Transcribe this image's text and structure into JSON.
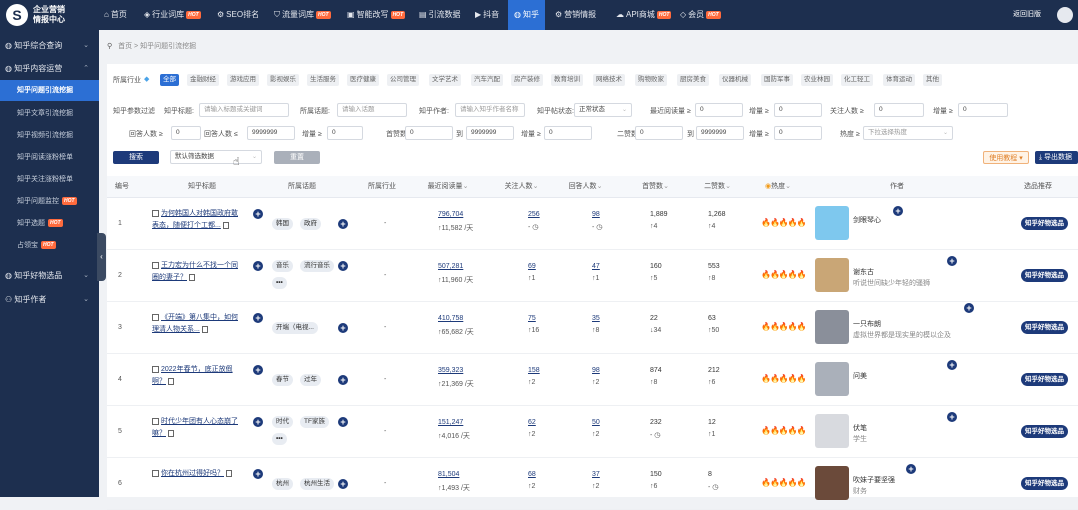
{
  "brand": {
    "line1": "企业营销",
    "line2": "情报中心",
    "mark": "S"
  },
  "nav": [
    {
      "label": "首页",
      "icon": "home-icon",
      "glyph": "⌂"
    },
    {
      "label": "行业词库",
      "icon": "cube-icon",
      "glyph": "◈",
      "hot": "HOT"
    },
    {
      "label": "SEO排名",
      "icon": "gear-icon",
      "glyph": "⚙"
    },
    {
      "label": "流量词库",
      "icon": "shield-icon",
      "glyph": "⛉",
      "hot": "HOT"
    },
    {
      "label": "智能改写",
      "icon": "robot-icon",
      "glyph": "▣",
      "hot": "HOT"
    },
    {
      "label": "引流数据",
      "icon": "book-icon",
      "glyph": "▤"
    },
    {
      "label": "抖音",
      "icon": "video-icon",
      "glyph": "▶"
    },
    {
      "label": "知乎",
      "icon": "globe-icon",
      "glyph": "◍"
    },
    {
      "label": "营销情报",
      "icon": "gear-icon",
      "glyph": "⚙"
    },
    {
      "label": "API商城",
      "icon": "cloud-icon",
      "glyph": "☁",
      "hot": "HOT"
    },
    {
      "label": "会员",
      "icon": "diamond-icon",
      "glyph": "◇",
      "hot": "HOT"
    }
  ],
  "back_old": "返回旧版",
  "sidebar": {
    "groups": [
      {
        "label": "知乎综合查询",
        "icon": "globe-icon"
      },
      {
        "label": "知乎内容运营",
        "icon": "globe-icon"
      },
      {
        "label": "知乎好物选品",
        "icon": "globe-icon"
      },
      {
        "label": "知乎作者",
        "icon": "user-icon"
      }
    ],
    "items": [
      {
        "label": "知乎问题引流挖掘"
      },
      {
        "label": "知乎文章引流挖掘"
      },
      {
        "label": "知乎视频引流挖掘"
      },
      {
        "label": "知乎阅读涨粉榜单"
      },
      {
        "label": "知乎关注涨粉榜单"
      },
      {
        "label": "知乎问题监控",
        "hot": "HOT"
      },
      {
        "label": "知乎选题",
        "hot": "HOT"
      },
      {
        "label": "占领宝",
        "hot": "HOT"
      }
    ]
  },
  "breadcrumb": {
    "home": "首页",
    "sep": ">",
    "current": "知乎问题引流挖掘"
  },
  "industry": {
    "label": "所属行业",
    "chips": [
      "全部",
      "金融财经",
      "游戏应用",
      "影视娱乐",
      "生活服务",
      "医疗健康",
      "公司管理",
      "文学艺术",
      "汽车汽配",
      "房产装修",
      "教育培训",
      "网络技术",
      "购物败家",
      "厨房美食",
      "仪器机械",
      "国防军事",
      "农业林园",
      "化工轻工",
      "体育运动",
      "其他"
    ]
  },
  "filters": {
    "section_label": "知乎参数过滤",
    "title_label": "知乎标题:",
    "title_ph": "请输入标题或关键词",
    "topic_label": "所属话题:",
    "topic_ph": "请输入话题",
    "author_label": "知乎作者:",
    "author_ph": "请输入知乎作者名称",
    "status_label": "知乎帖状态:",
    "status_value": "正常状态",
    "readmax_label": "最近阅读量 ≥",
    "readmax_val": "0",
    "inc1_label": "增量 ≥",
    "inc1_val": "0",
    "follow_label": "关注人数 ≥",
    "follow_val": "0",
    "inc2_label": "增量 ≥",
    "inc2_val": "0",
    "answer_label": "回答人数 ≥",
    "answer_val": "0",
    "answer2_label": "回答人数 ≤",
    "answer2_val": "9999999",
    "inc3_label": "增量 ≥",
    "inc3_val": "0",
    "likes_label": "首赞数",
    "likes_from": "0",
    "to1": "到",
    "likes_to": "9999999",
    "inc4_label": "增量 ≥",
    "inc4_val": "0",
    "likes2_label": "二赞数",
    "likes2_from": "0",
    "to2": "到",
    "likes2_to": "9999999",
    "inc5_label": "增量 ≥",
    "inc5_val": "0",
    "heat_label": "热度 ≥",
    "heat_ph": "下拉选择热度"
  },
  "actions": {
    "search": "搜索",
    "sort_value": "默认筛选数据",
    "reset": "重置",
    "tutorial": "使用教程 ▾",
    "export": "导出数据"
  },
  "columns": [
    "编号",
    "知乎标题",
    "所属话题",
    "所属行业",
    "最近阅读量",
    "关注人数",
    "回答人数",
    "首赞数",
    "二赞数",
    "热度",
    "作者",
    "选品推荐"
  ],
  "rows": [
    {
      "no": "1",
      "title": "为何韩国人对韩国政府敢表态，随便打个工都...",
      "tags": [
        "韩国",
        "政府"
      ],
      "industry": "-",
      "read": "796,704",
      "read_d": "↑11,582 /天",
      "follow": "256",
      "follow_d": "- ◷",
      "answer": "98",
      "answer_d": "- ◷",
      "like1": "1,889",
      "like1_d": "↑4",
      "like2": "1,268",
      "like2_d": "↑4",
      "heat": "🔥🔥🔥🔥🔥",
      "author": "剑眼琴心",
      "author_desc": "",
      "rec": "知乎好物选品",
      "av": "#7ec8ee"
    },
    {
      "no": "2",
      "title": "王力宏为什么不找一个同圈的妻子？",
      "tags": [
        "音乐",
        "流行音乐"
      ],
      "more": true,
      "industry": "-",
      "read": "507,281",
      "read_d": "↑11,960 /天",
      "follow": "69",
      "follow_d": "↑1",
      "answer": "47",
      "answer_d": "↑1",
      "like1": "160",
      "like1_d": "↑5",
      "like2": "553",
      "like2_d": "↑8",
      "heat": "🔥🔥🔥🔥🔥",
      "author": "谢东古",
      "author_desc": "听说世间缺少年轻的骚狮",
      "rec": "知乎好物选品",
      "av": "#c9a676"
    },
    {
      "no": "3",
      "title": "《开端》第八集中，如何理清人物关系...",
      "tags": [
        "开端（电视..."
      ],
      "industry": "-",
      "read": "410,758",
      "read_d": "↑65,682 /天",
      "follow": "75",
      "follow_d": "↑16",
      "answer": "35",
      "answer_d": "↑8",
      "like1": "22",
      "like1_d": "↓34",
      "like2": "63",
      "like2_d": "↑50",
      "heat": "🔥🔥🔥🔥🔥",
      "author": "一只布朗",
      "author_desc": "虚拟世界都是现实里的模以企及",
      "rec": "知乎好物选品",
      "av": "#8a8f9a"
    },
    {
      "no": "4",
      "title": "2022年春节，底正放假啊？",
      "tags": [
        "春节",
        "过年"
      ],
      "industry": "-",
      "read": "359,323",
      "read_d": "↑21,369 /天",
      "follow": "158",
      "follow_d": "↑2",
      "answer": "98",
      "answer_d": "↑2",
      "like1": "874",
      "like1_d": "↑8",
      "like2": "212",
      "like2_d": "↑6",
      "heat": "🔥🔥🔥🔥🔥",
      "author": "问美",
      "author_desc": "",
      "rec": "知乎好物选品",
      "av": "#aab0ba"
    },
    {
      "no": "5",
      "title": "时代少年团有人心态崩了嘛？",
      "tags": [
        "时代",
        "TF家族"
      ],
      "more": true,
      "industry": "-",
      "read": "151,247",
      "read_d": "↑4,016 /天",
      "follow": "62",
      "follow_d": "↑2",
      "answer": "50",
      "answer_d": "↑2",
      "like1": "232",
      "like1_d": "- ◷",
      "like2": "12",
      "like2_d": "↑1",
      "heat": "🔥🔥🔥🔥🔥",
      "author": "伏笔",
      "author_desc": "学生",
      "rec": "知乎好物选品",
      "av": "#d8dadf"
    },
    {
      "no": "6",
      "title": "你在杭州过得好吗？",
      "tags": [
        "杭州",
        "杭州生活"
      ],
      "industry": "-",
      "read": "81,504",
      "read_d": "↑1,493 /天",
      "follow": "68",
      "follow_d": "↑2",
      "answer": "37",
      "answer_d": "↑2",
      "like1": "150",
      "like1_d": "↑6",
      "like2": "8",
      "like2_d": "- ◷",
      "heat": "🔥🔥🔥🔥🔥",
      "author": "吹妹子要坚强",
      "author_desc": "财务",
      "rec": "知乎好物选品",
      "av": "#6b4a3a"
    }
  ]
}
